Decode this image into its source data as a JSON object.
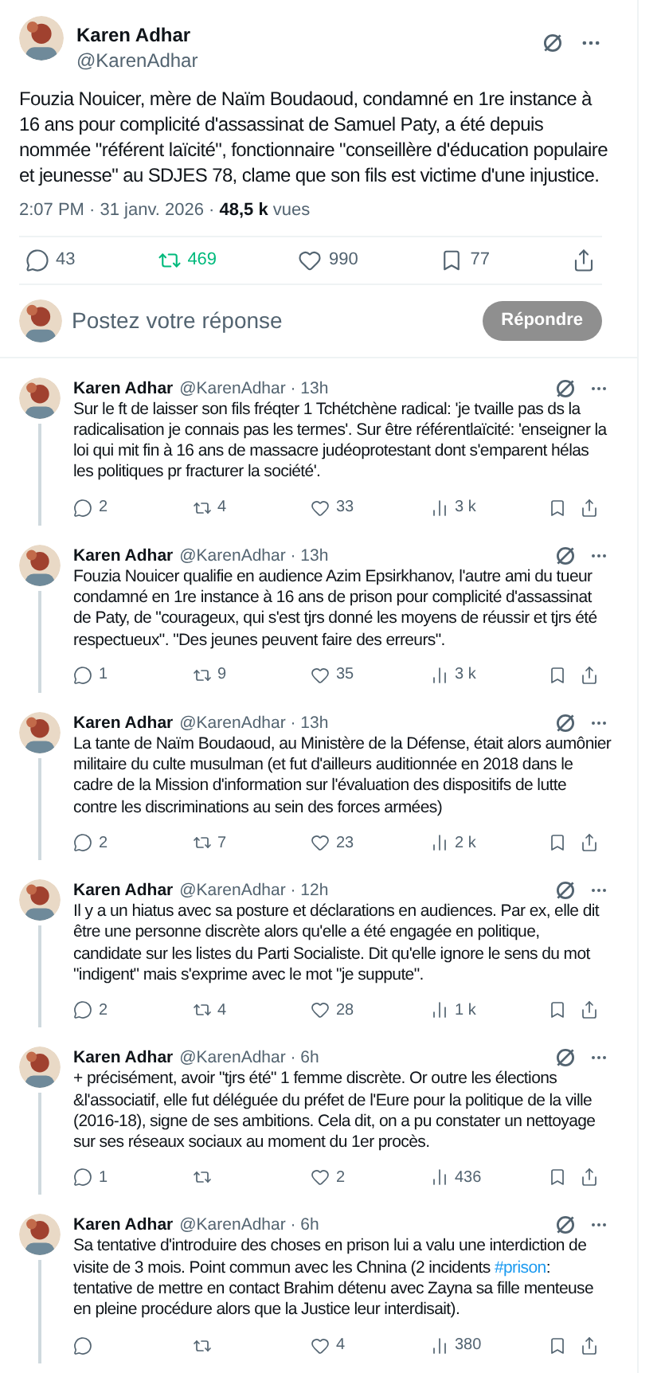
{
  "tweet": {
    "author": "Karen Adhar",
    "handle": "@KarenAdhar",
    "text": "Fouzia Nouicer, mère de Naïm Boudaoud, condamné en 1re instance à 16 ans pour complicité d'assassinat de Samuel Paty, a été depuis nommée \"référent laïcité\", fonctionnaire \"conseillère d'éducation populaire et jeunesse\" au SDJES 78, clame que son fils est victime d'une injustice.",
    "time": "2:07 PM · 31 janv. 2026 · ",
    "views": "48,5 k",
    "views_label": " vues",
    "stats": [
      {
        "kind": "reply",
        "count": "43",
        "active": false
      },
      {
        "kind": "repost",
        "count": "469",
        "active": true
      },
      {
        "kind": "like",
        "count": "990",
        "active": false
      },
      {
        "kind": "bookmark",
        "count": "77",
        "active": false
      },
      {
        "kind": "share",
        "active": false
      }
    ]
  },
  "composer": {
    "placeholder": "Postez votre réponse",
    "button": "Répondre",
    "disabled": true
  },
  "replies": [
    {
      "author": "Karen Adhar",
      "handle": "@KarenAdhar · 13h",
      "parts": [
        {
          "kind": "text",
          "text": "Sur le ft de laisser son fils fréqter 1 Tchétchène radical: 'je tvaille pas ds la radicalisation je connais pas les termes'. Sur être référentlaïcité: 'enseigner la loi qui mit fin à 16 ans de massacre judéoprotestant dont s'emparent hélas les politiques pr fracturer la société'."
        }
      ],
      "stats": [
        {
          "kind": "reply",
          "count": "2"
        },
        {
          "kind": "repost",
          "count": "4"
        },
        {
          "kind": "like",
          "count": "33"
        },
        {
          "kind": "views",
          "count": "3 k"
        },
        {
          "kind": "bookmark"
        },
        {
          "kind": "share"
        }
      ]
    },
    {
      "author": "Karen Adhar",
      "handle": "@KarenAdhar · 13h",
      "parts": [
        {
          "kind": "text",
          "text": "Fouzia Nouicer qualifie en audience Azim Epsirkhanov, l'autre ami du tueur condamné en 1re instance à 16 ans de prison pour complicité d'assassinat de Paty, de \"courageux, qui s'est tjrs donné les moyens de réussir et tjrs été respectueux\". \"Des jeunes peuvent faire des erreurs\"."
        }
      ],
      "stats": [
        {
          "kind": "reply",
          "count": "1"
        },
        {
          "kind": "repost",
          "count": "9"
        },
        {
          "kind": "like",
          "count": "35"
        },
        {
          "kind": "views",
          "count": "3 k"
        },
        {
          "kind": "bookmark"
        },
        {
          "kind": "share"
        }
      ]
    },
    {
      "author": "Karen Adhar",
      "handle": "@KarenAdhar · 13h",
      "parts": [
        {
          "kind": "text",
          "text": "La tante de Naïm Boudaoud, au Ministère de la Défense, était alors aumônier militaire du culte musulman (et fut d'ailleurs auditionnée en 2018 dans le cadre de la Mission d'information sur l'évaluation des dispositifs de lutte contre les discriminations au sein des forces armées)"
        }
      ],
      "stats": [
        {
          "kind": "reply",
          "count": "2"
        },
        {
          "kind": "repost",
          "count": "7"
        },
        {
          "kind": "like",
          "count": "23"
        },
        {
          "kind": "views",
          "count": "2 k"
        },
        {
          "kind": "bookmark"
        },
        {
          "kind": "share"
        }
      ]
    },
    {
      "author": "Karen Adhar",
      "handle": "@KarenAdhar · 12h",
      "parts": [
        {
          "kind": "text",
          "text": "Il y a un hiatus avec sa posture et déclarations en audiences. Par ex, elle dit être une personne discrète alors qu'elle a été engagée en politique, candidate sur les listes du Parti Socialiste. Dit qu'elle ignore le sens du mot \"indigent\" mais s'exprime avec le mot \"je suppute\"."
        }
      ],
      "stats": [
        {
          "kind": "reply",
          "count": "2"
        },
        {
          "kind": "repost",
          "count": "4"
        },
        {
          "kind": "like",
          "count": "28"
        },
        {
          "kind": "views",
          "count": "1 k"
        },
        {
          "kind": "bookmark"
        },
        {
          "kind": "share"
        }
      ]
    },
    {
      "author": "Karen Adhar",
      "handle": "@KarenAdhar · 6h",
      "parts": [
        {
          "kind": "text",
          "text": "+ précisément, avoir \"tjrs été\" 1 femme discrète. Or outre les élections &l'associatif, elle fut déléguée du préfet de l'Eure pour la politique de la ville (2016-18), signe de ses ambitions. Cela dit, on a pu constater un nettoyage sur ses réseaux sociaux au moment du 1er procès."
        }
      ],
      "stats": [
        {
          "kind": "reply",
          "count": "1"
        },
        {
          "kind": "repost"
        },
        {
          "kind": "like",
          "count": "2"
        },
        {
          "kind": "views",
          "count": "436"
        },
        {
          "kind": "bookmark"
        },
        {
          "kind": "share"
        }
      ]
    },
    {
      "author": "Karen Adhar",
      "handle": "@KarenAdhar · 6h",
      "parts": [
        {
          "kind": "text",
          "text": "Sa tentative d'introduire des choses en prison lui a valu une interdiction de visite de 3 mois. Point commun avec les Chnina (2 incidents "
        },
        {
          "kind": "hashtag",
          "text": "#prison"
        },
        {
          "kind": "text",
          "text": ": tentative de mettre en contact Brahim détenu avec Zayna sa fille menteuse en pleine procédure alors que la Justice leur interdisait)."
        }
      ],
      "stats": [
        {
          "kind": "reply"
        },
        {
          "kind": "repost"
        },
        {
          "kind": "like",
          "count": "4"
        },
        {
          "kind": "views",
          "count": "380"
        },
        {
          "kind": "bookmark"
        },
        {
          "kind": "share"
        }
      ]
    }
  ]
}
